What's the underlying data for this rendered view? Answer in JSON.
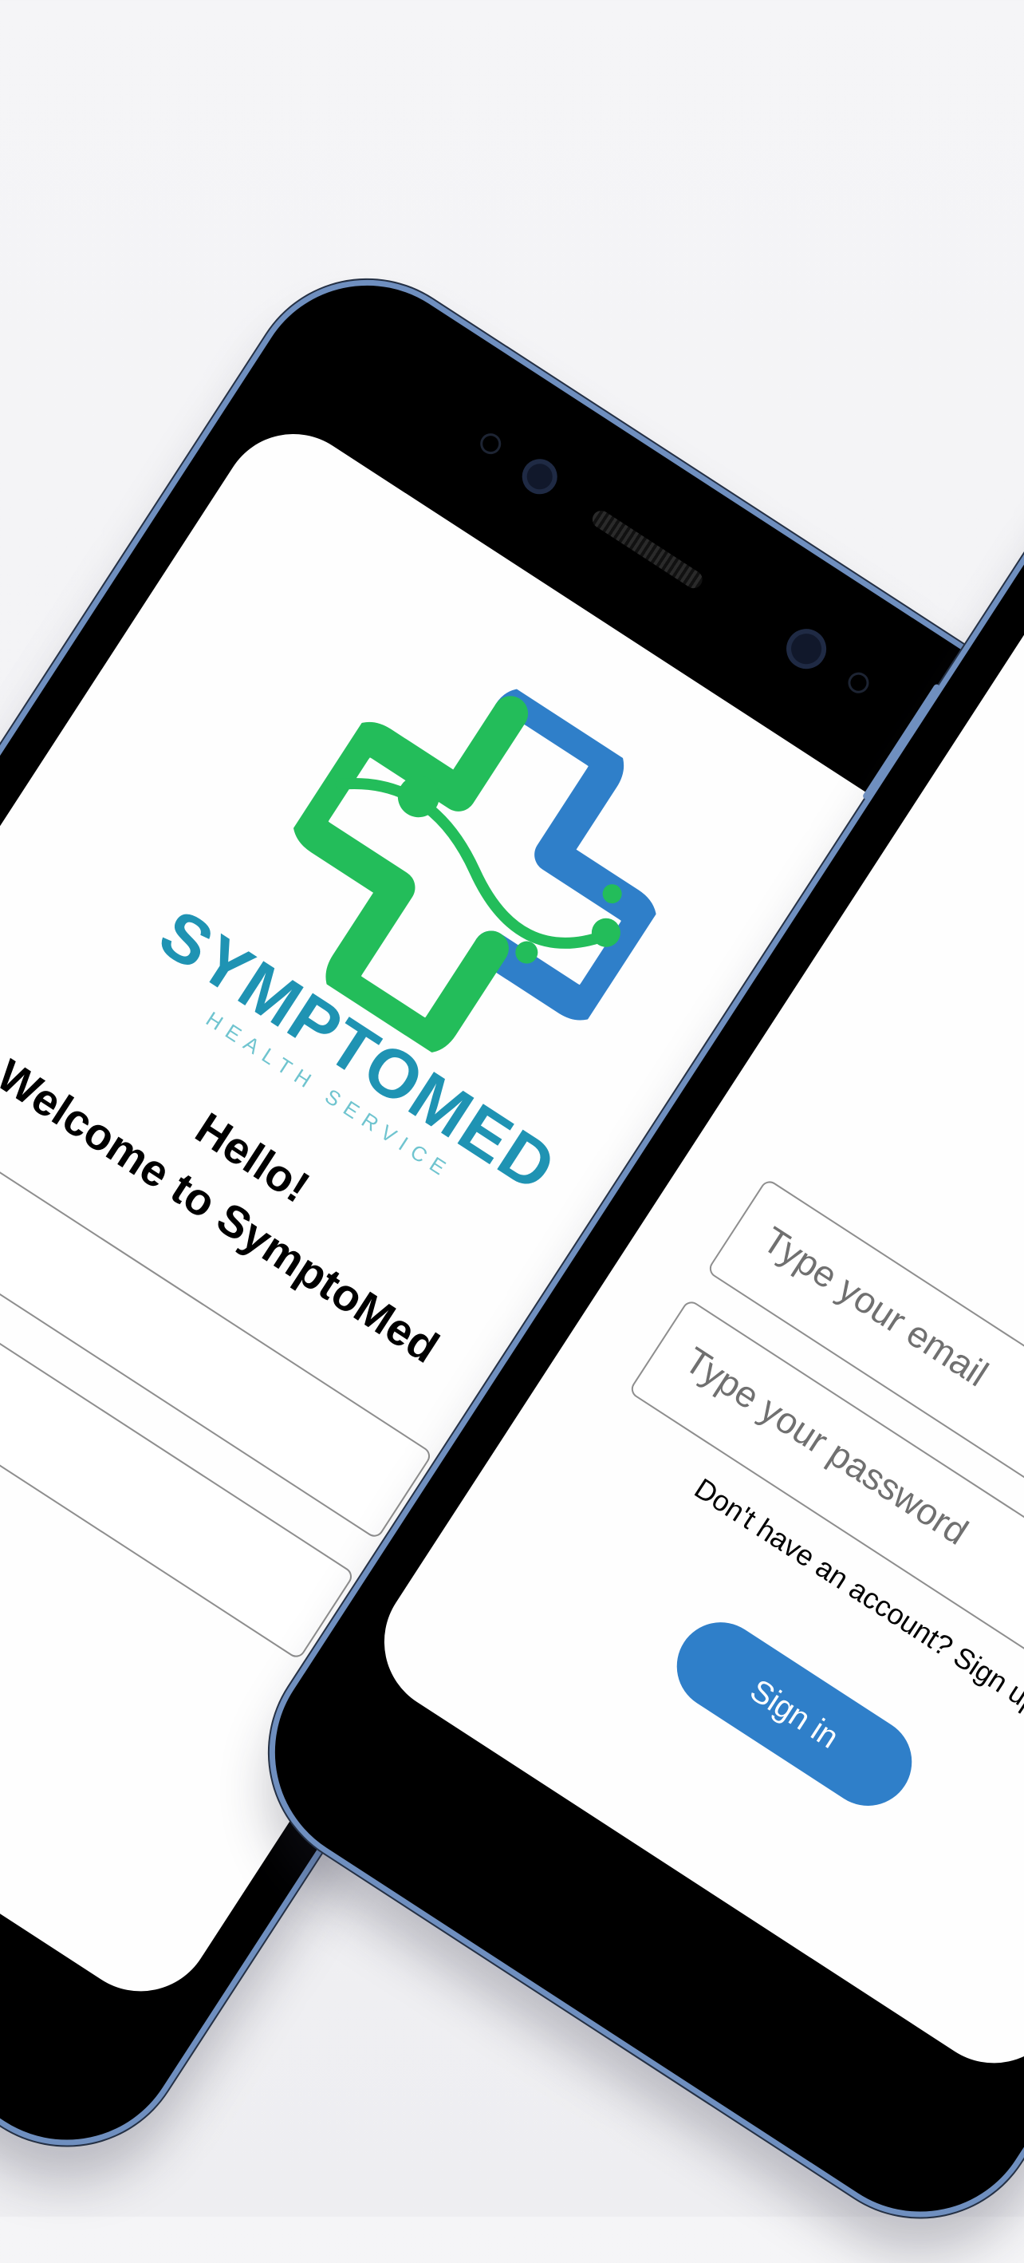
{
  "brand": {
    "name": "SYMPTOMED",
    "tagline": "HEALTH SERVICE",
    "colors": {
      "blue": "#2f7fc9",
      "green": "#23bd5a",
      "teal": "#1f93b3"
    }
  },
  "phone_left": {
    "greeting": "Hello!",
    "welcome": "Welcome to SymptoMed",
    "email_placeholder": "",
    "password_placeholder": ""
  },
  "phone_right": {
    "email_placeholder": "Type your email",
    "password_placeholder": "Type your password",
    "signup_prompt": "Don't have an account? Sign up",
    "signin_label": "Sign in"
  }
}
